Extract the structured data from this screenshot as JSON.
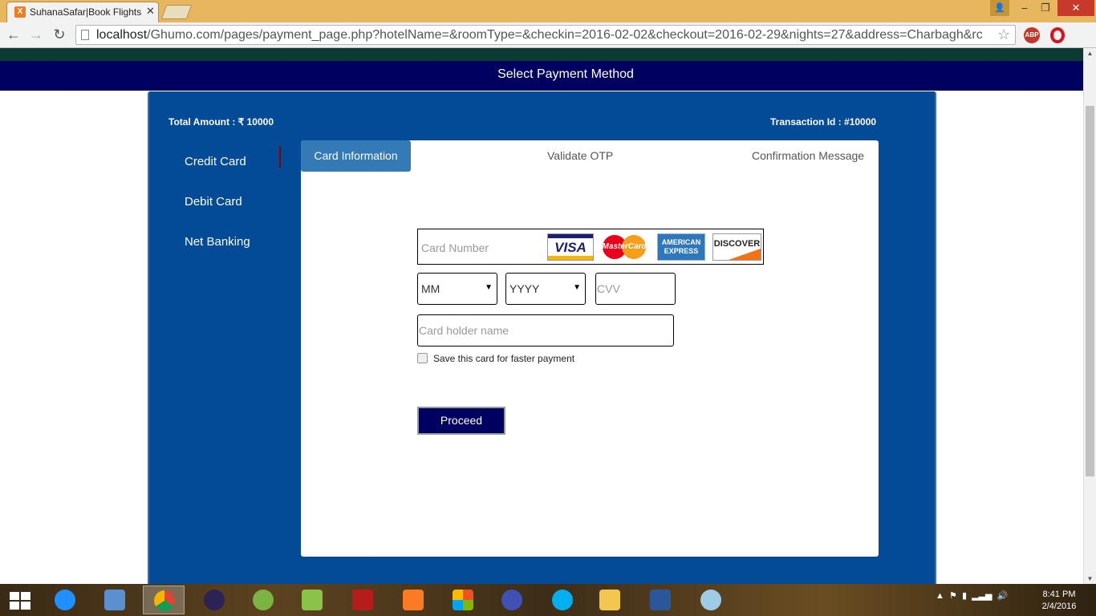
{
  "browser": {
    "tab_title": "SuhanaSafar|Book Flights,",
    "tab_close": "✕",
    "url_host": "localhost",
    "url_path": "/Ghumo.com/pages/payment_page.php?hotelName=&roomType=&checkin=2016-02-02&checkout=2016-02-29&nights=27&address=Charbagh&rc",
    "abp_label": "ABP"
  },
  "page": {
    "title": "Select Payment Method",
    "total_amount": "Total Amount : ₹ 10000",
    "transaction_id": "Transaction Id : #10000"
  },
  "methods": [
    {
      "label": "Credit Card"
    },
    {
      "label": "Debit Card"
    },
    {
      "label": "Net Banking"
    }
  ],
  "steps": [
    {
      "label": "Card Information"
    },
    {
      "label": "Validate OTP"
    },
    {
      "label": "Confirmation Message"
    }
  ],
  "form": {
    "card_number_placeholder": "Card Number",
    "month_value": "MM",
    "year_value": "YYYY",
    "cvv_placeholder": "CVV",
    "holder_placeholder": "Card holder name",
    "save_label": "Save this card for faster payment",
    "proceed_label": "Proceed",
    "card_logos": {
      "visa": "VISA",
      "mastercard": "MasterCard",
      "amex": "AMERICAN EXPRESS",
      "discover": "DISCOVER"
    }
  },
  "taskbar": {
    "time": "8:41 PM",
    "date": "2/4/2016"
  },
  "colors": {
    "header": "#000060",
    "panel": "#034a97",
    "active_step": "#337ab7"
  }
}
